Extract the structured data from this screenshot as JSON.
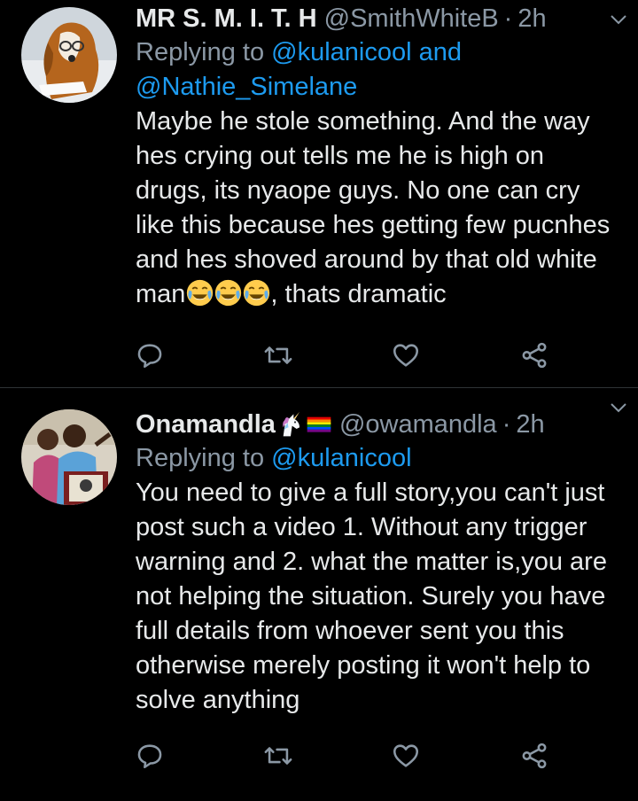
{
  "tweets": [
    {
      "name": "MR S. M. I. T. H",
      "handle": "@SmithWhiteB",
      "dot": "·",
      "time": "2h",
      "replying_prefix": "Replying to ",
      "replying_users": [
        "@kulanicool",
        "@Nathie_Simelane"
      ],
      "replying_joiner": " and ",
      "body_text": "Maybe he stole something. And the way hes crying out tells me he is high on drugs, its nyaope guys. No one can cry like this because hes getting few pucnhes and hes shoved around by that old white man",
      "body_suffix": ", thats dramatic",
      "emojis": [
        "face-with-tears-of-joy",
        "face-with-tears-of-joy",
        "face-with-tears-of-joy"
      ]
    },
    {
      "name": "Onamandla",
      "name_emojis": [
        "unicorn",
        "rainbow-flag"
      ],
      "handle": "@owamandla",
      "dot": "·",
      "time": "2h",
      "replying_prefix": "Replying to ",
      "replying_users": [
        "@kulanicool"
      ],
      "body_text": "You need to give a full story,you can't just post such a video 1. Without any trigger warning and 2. what the matter is,you are not helping the situation. Surely you have full details from whoever sent you this otherwise merely posting it won't help to solve anything"
    }
  ],
  "actions": [
    "reply-icon",
    "retweet-icon",
    "like-icon",
    "share-icon"
  ],
  "colors": {
    "background": "#000000",
    "text": "#e7e9ea",
    "muted": "#8b98a5",
    "link": "#1d9bf0",
    "divider": "#2f3336"
  }
}
